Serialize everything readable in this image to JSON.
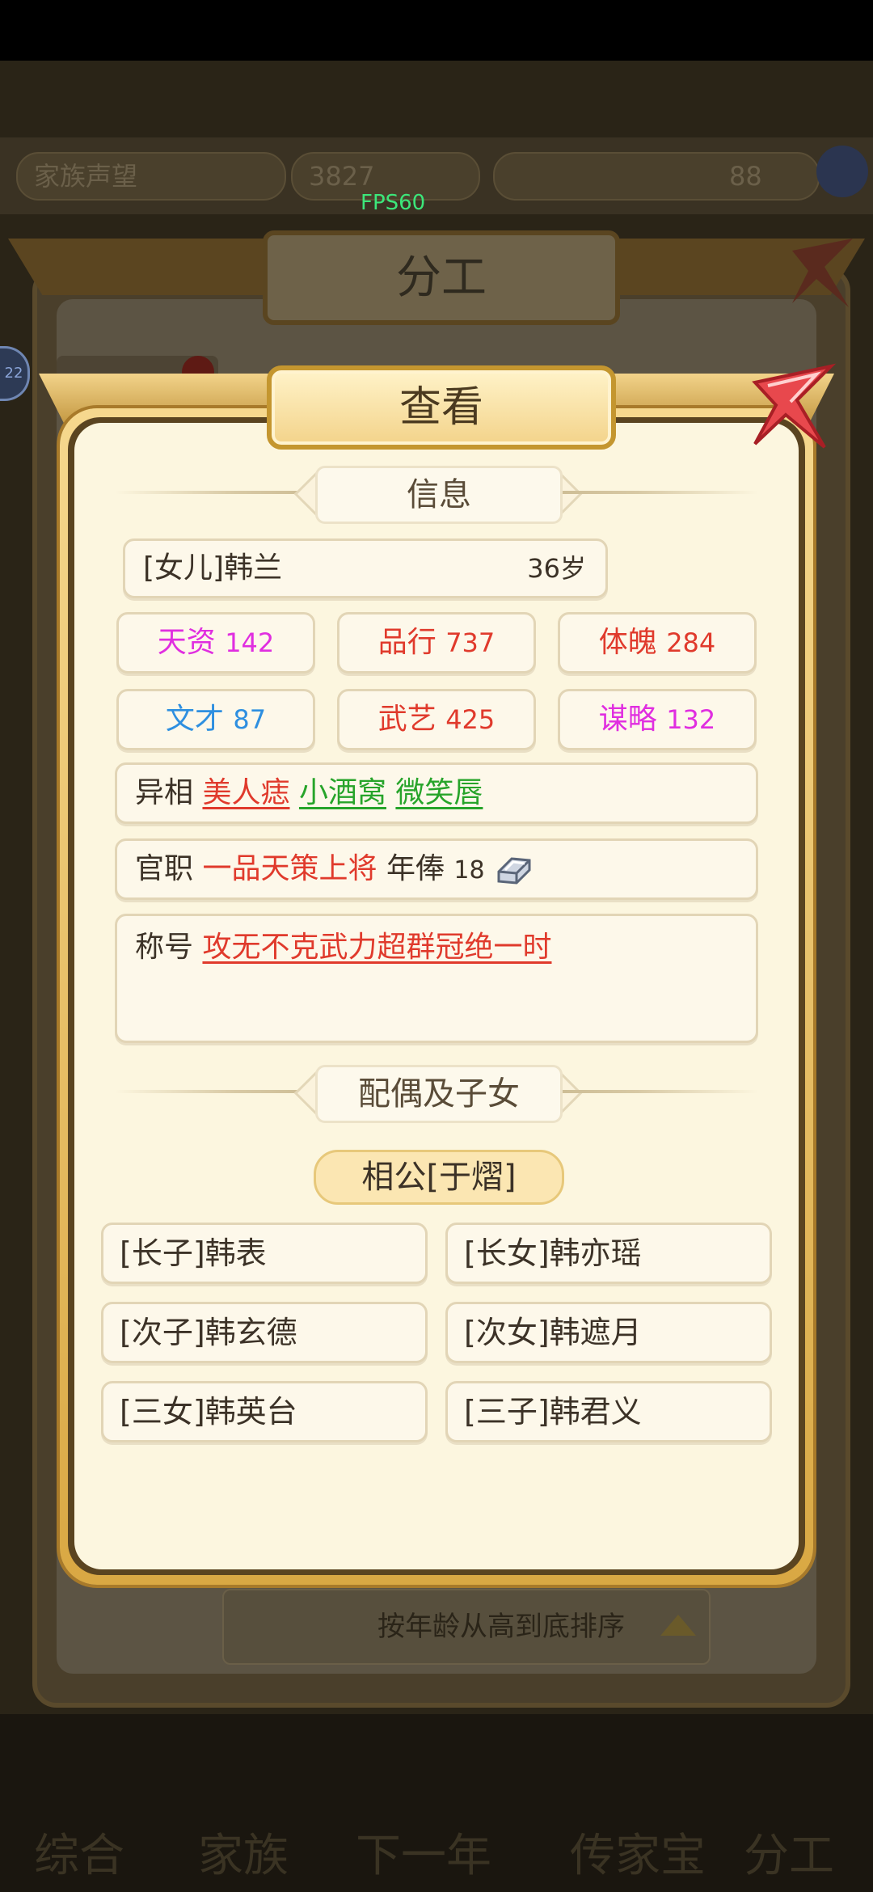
{
  "fps": "FPS60",
  "background": {
    "top_pills": [
      "家族声望",
      "3827",
      "88"
    ],
    "panel_title": "分工",
    "badge": "22",
    "sort_label": "按年龄从高到底排序",
    "nav": [
      "综合",
      "家族",
      "下一年",
      "传家宝",
      "分工"
    ]
  },
  "modal": {
    "title": "查看",
    "info_section": "信息",
    "name": "[女儿]韩兰",
    "age": "36岁",
    "stats": [
      {
        "label": "天资",
        "value": "142",
        "color": "#e02ee0"
      },
      {
        "label": "品行",
        "value": "737",
        "color": "#e03a2c"
      },
      {
        "label": "体魄",
        "value": "284",
        "color": "#e03a2c"
      },
      {
        "label": "文才",
        "value": "87",
        "color": "#2e8fe0"
      },
      {
        "label": "武艺",
        "value": "425",
        "color": "#e03a2c"
      },
      {
        "label": "谋略",
        "value": "132",
        "color": "#e02ee0"
      }
    ],
    "traits_label": "异相",
    "traits": [
      {
        "text": "美人痣",
        "color": "#e03a2c"
      },
      {
        "text": "小酒窝",
        "color": "#27a42a"
      },
      {
        "text": "微笑唇",
        "color": "#27a42a"
      }
    ],
    "office_label": "官职",
    "office": "一品天策上将",
    "salary_label": "年俸",
    "salary": "18",
    "title_label": "称号",
    "honor": "攻无不克武力超群冠绝一时",
    "family_section": "配偶及子女",
    "spouse": "相公[于熠]",
    "children": [
      "[长子]韩表",
      "[长女]韩亦瑶",
      "[次子]韩玄德",
      "[次女]韩遮月",
      "[三女]韩英台",
      "[三子]韩君义"
    ]
  }
}
